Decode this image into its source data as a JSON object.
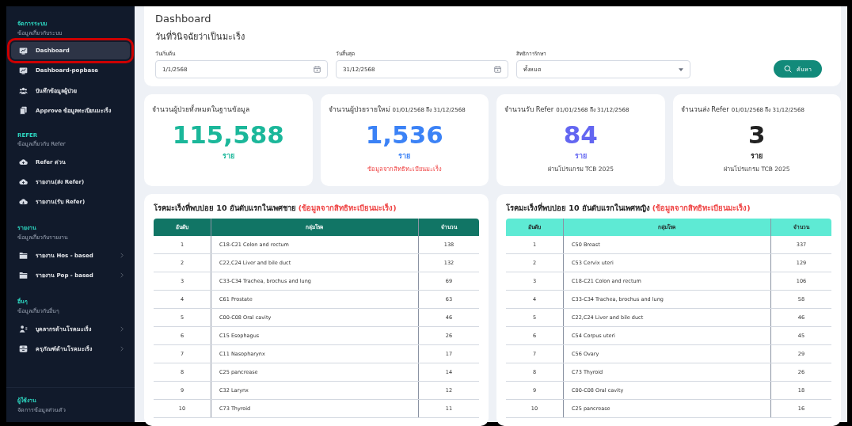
{
  "sidebar": {
    "sections": [
      {
        "title": "จัดการระบบ",
        "subtitle": "ข้อมูลเกี่ยวกับระบบ",
        "items": [
          {
            "label": "Dashboard",
            "selected": true,
            "highlighted": true,
            "expandable": false
          },
          {
            "label": "Dashboard-popbase",
            "selected": false,
            "highlighted": false,
            "expandable": false
          },
          {
            "label": "บันทึกข้อมูลผู้ป่วย",
            "selected": false,
            "highlighted": false,
            "expandable": false
          },
          {
            "label": "Approve ข้อมูลทะเบียนมะเร็ง",
            "selected": false,
            "highlighted": false,
            "expandable": false
          }
        ]
      },
      {
        "title": "REFER",
        "subtitle": "ข้อมูลเกี่ยวกับ Refer",
        "items": [
          {
            "label": "Refer ด่วน",
            "selected": false,
            "highlighted": false,
            "expandable": false
          },
          {
            "label": "รายงาน(ส่ง Refer)",
            "selected": false,
            "highlighted": false,
            "expandable": false
          },
          {
            "label": "รายงาน(รับ Refer)",
            "selected": false,
            "highlighted": false,
            "expandable": false
          }
        ]
      },
      {
        "title": "รายงาน",
        "subtitle": "ข้อมูลเกี่ยวกับรายงาน",
        "items": [
          {
            "label": "รายงาน Hos - based",
            "selected": false,
            "highlighted": false,
            "expandable": true
          },
          {
            "label": "รายงาน Pop - based",
            "selected": false,
            "highlighted": false,
            "expandable": true
          }
        ]
      },
      {
        "title": "อื่นๆ",
        "subtitle": "ข้อมูลเกี่ยวกับอื่นๆ",
        "items": [
          {
            "label": "บุคลากรด้านโรคมะเร็ง",
            "selected": false,
            "highlighted": false,
            "expandable": true
          },
          {
            "label": "ครุภัณฑ์ด้านโรคมะเร็ง",
            "selected": false,
            "highlighted": false,
            "expandable": true
          }
        ]
      },
      {
        "title": "ผู้ใช้งาน",
        "subtitle": "จัดการข้อมูลส่วนตัว"
      }
    ]
  },
  "header": {
    "title": "Dashboard",
    "subtitle": "วันที่วินิจฉัยว่าเป็นมะเร็ง"
  },
  "filters": [
    {
      "kind": "date",
      "label": "วันเริ่มต้น",
      "value": "1/1/2568"
    },
    {
      "kind": "date",
      "label": "วันสิ้นสุด",
      "value": "31/12/2568"
    },
    {
      "kind": "select",
      "label": "สิทธิการรักษา",
      "value": "ทั้งหมด"
    }
  ],
  "search_button": "ค้นหา",
  "stat_cards": [
    {
      "title": "จำนวนผู้ป่วยทั้งหมดในฐานข้อมูล",
      "value": "115,588",
      "color": "#1bb79a",
      "unit": "ราย"
    },
    {
      "title": "จำนวนผู้ป่วยรายใหม่",
      "period": "01/01/2568 ถึง 31/12/2568",
      "value": "1,536",
      "color": "#3b82f6",
      "unit": "ราย",
      "note": {
        "kind": "warning",
        "text": "ข้อมูลจากสิทธิทะเบียนมะเร็ง"
      }
    },
    {
      "title": "จำนวนรับ Refer",
      "period": "01/01/2568 ถึง 31/12/2568",
      "value": "84",
      "color": "#6366f1",
      "unit": "ราย",
      "note": {
        "kind": "info",
        "text": "ผ่านโปรแกรม TCB 2025"
      }
    },
    {
      "title": "จำนวนส่ง Refer",
      "period": "01/01/2568 ถึง 31/12/2568",
      "value": "3",
      "color": "#222222",
      "unit": "ราย",
      "note": {
        "kind": "info",
        "text": "ผ่านโปรแกรม TCB 2025"
      }
    }
  ],
  "tables": [
    {
      "title": "โรคมะเร็งที่พบบ่อย 10 อันดับแรกในเพศชาย",
      "source": "(ข้อมูลจากสิทธิทะเบียนมะเร็ง)",
      "color": "#117565",
      "columns": [
        "อันดับ",
        "กลุ่มโรค",
        "จำนวน"
      ],
      "rows": [
        [
          "1",
          "C18-C21 Colon and rectum",
          "138"
        ],
        [
          "2",
          "C22,C24 Liver and bile duct",
          "132"
        ],
        [
          "3",
          "C33-C34 Trachea, brochus and lung",
          "69"
        ],
        [
          "4",
          "C61 Prostate",
          "63"
        ],
        [
          "5",
          "C00-C08 Oral cavity",
          "46"
        ],
        [
          "6",
          "C15 Esophagus",
          "26"
        ],
        [
          "7",
          "C11 Nasopharynx",
          "17"
        ],
        [
          "8",
          "C25 pancrease",
          "14"
        ],
        [
          "9",
          "C32 Larynx",
          "12"
        ],
        [
          "10",
          "C73 Thyroid",
          "11"
        ]
      ]
    },
    {
      "title": "โรคมะเร็งที่พบบ่อย 10 อันดับแรกในเพศหญิง",
      "source": "(ข้อมูลจากสิทธิทะเบียนมะเร็ง)",
      "color": "#5eead4",
      "columns": [
        "อันดับ",
        "กลุ่มโรค",
        "จำนวน"
      ],
      "rows": [
        [
          "1",
          "C50 Breast",
          "337"
        ],
        [
          "2",
          "C53 Cervix uteri",
          "129"
        ],
        [
          "3",
          "C18-C21 Colon and rectum",
          "106"
        ],
        [
          "4",
          "C33-C34 Trachea, brochus and lung",
          "58"
        ],
        [
          "5",
          "C22,C24 Liver and bile duct",
          "46"
        ],
        [
          "6",
          "C54 Corpus uteri",
          "45"
        ],
        [
          "7",
          "C56 Ovary",
          "29"
        ],
        [
          "8",
          "C73 Thyroid",
          "26"
        ],
        [
          "9",
          "C00-C08 Oral cavity",
          "18"
        ],
        [
          "10",
          "C25 pancrease",
          "16"
        ]
      ]
    }
  ]
}
